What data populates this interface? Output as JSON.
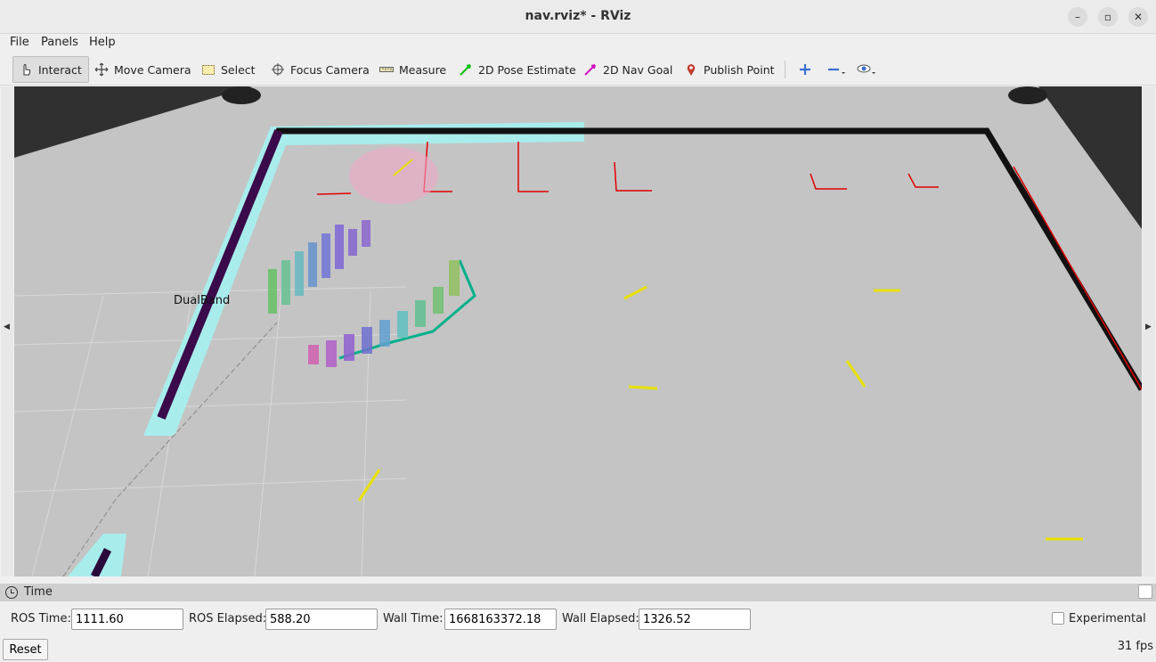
{
  "window": {
    "title": "nav.rviz* - RViz"
  },
  "menu": [
    {
      "label": "File",
      "mnemonic": "F"
    },
    {
      "label": "Panels",
      "mnemonic": "P"
    },
    {
      "label": "Help",
      "mnemonic": "H"
    }
  ],
  "toolbar": {
    "tools": [
      {
        "label": "Interact",
        "icon": "hand-pointer-icon",
        "active": true
      },
      {
        "label": "Move Camera",
        "icon": "move-arrows-icon"
      },
      {
        "label": "Select",
        "icon": "select-rect-icon"
      },
      {
        "label": "Focus Camera",
        "icon": "focus-target-icon"
      },
      {
        "label": "Measure",
        "icon": "ruler-icon"
      },
      {
        "label": "2D Pose Estimate",
        "icon": "green-arrow-icon"
      },
      {
        "label": "2D Nav Goal",
        "icon": "magenta-arrow-icon"
      },
      {
        "label": "Publish Point",
        "icon": "map-pin-icon"
      }
    ],
    "extra_icons": [
      "plus-icon",
      "minus-icon",
      "eye-icon"
    ]
  },
  "viewport": {
    "overlay_label": "DualBand",
    "colors": {
      "floor": "#c4c4c4",
      "background": "#303030",
      "wall": "#111111",
      "inflation": "#a9ecec",
      "laser": "#e00000",
      "goal_arrow": "#e8e000",
      "path": "#00b08a"
    }
  },
  "time_panel": {
    "title": "Time",
    "ros_time_label": "ROS Time:",
    "ros_time": "1111.60",
    "ros_elapsed_label": "ROS Elapsed:",
    "ros_elapsed": "588.20",
    "wall_time_label": "Wall Time:",
    "wall_time": "1668163372.18",
    "wall_elapsed_label": "Wall Elapsed:",
    "wall_elapsed": "1326.52",
    "experimental_label": "Experimental",
    "experimental_checked": false
  },
  "status": {
    "reset_label": "Reset",
    "fps": "31 fps"
  }
}
